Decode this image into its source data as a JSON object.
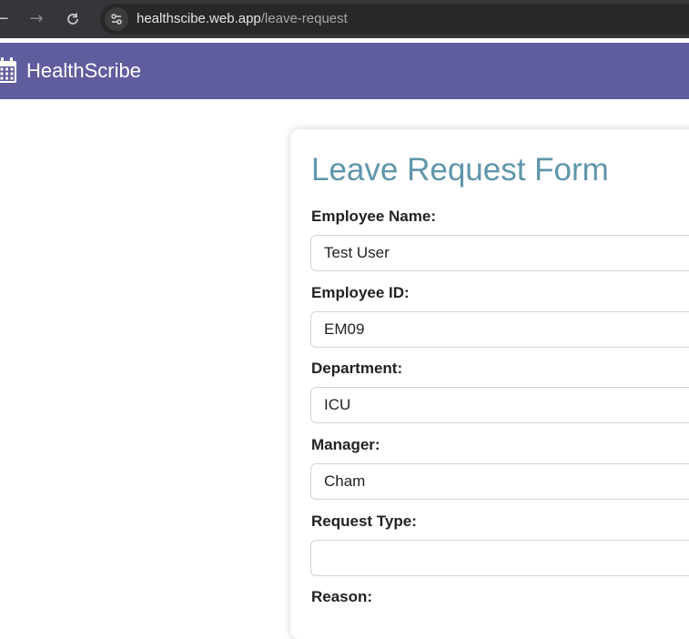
{
  "browser": {
    "back_icon": "arrow-left-icon",
    "forward_icon": "arrow-right-icon",
    "reload_icon": "reload-icon",
    "url_host": "healthscibe.web.app",
    "url_path": "/leave-request"
  },
  "header": {
    "brand_icon": "calendar-icon",
    "brand_name": "HealthScribe",
    "color": "#5f5d9e"
  },
  "form": {
    "title": "Leave Request Form",
    "title_color": "#5f96aa",
    "fields": [
      {
        "label": "Employee Name:",
        "value": "Test User"
      },
      {
        "label": "Employee ID:",
        "value": "EM09"
      },
      {
        "label": "Department:",
        "value": "ICU"
      },
      {
        "label": "Manager:",
        "value": "Cham"
      },
      {
        "label": "Request Type:",
        "value": ""
      },
      {
        "label": "Reason:"
      }
    ]
  }
}
